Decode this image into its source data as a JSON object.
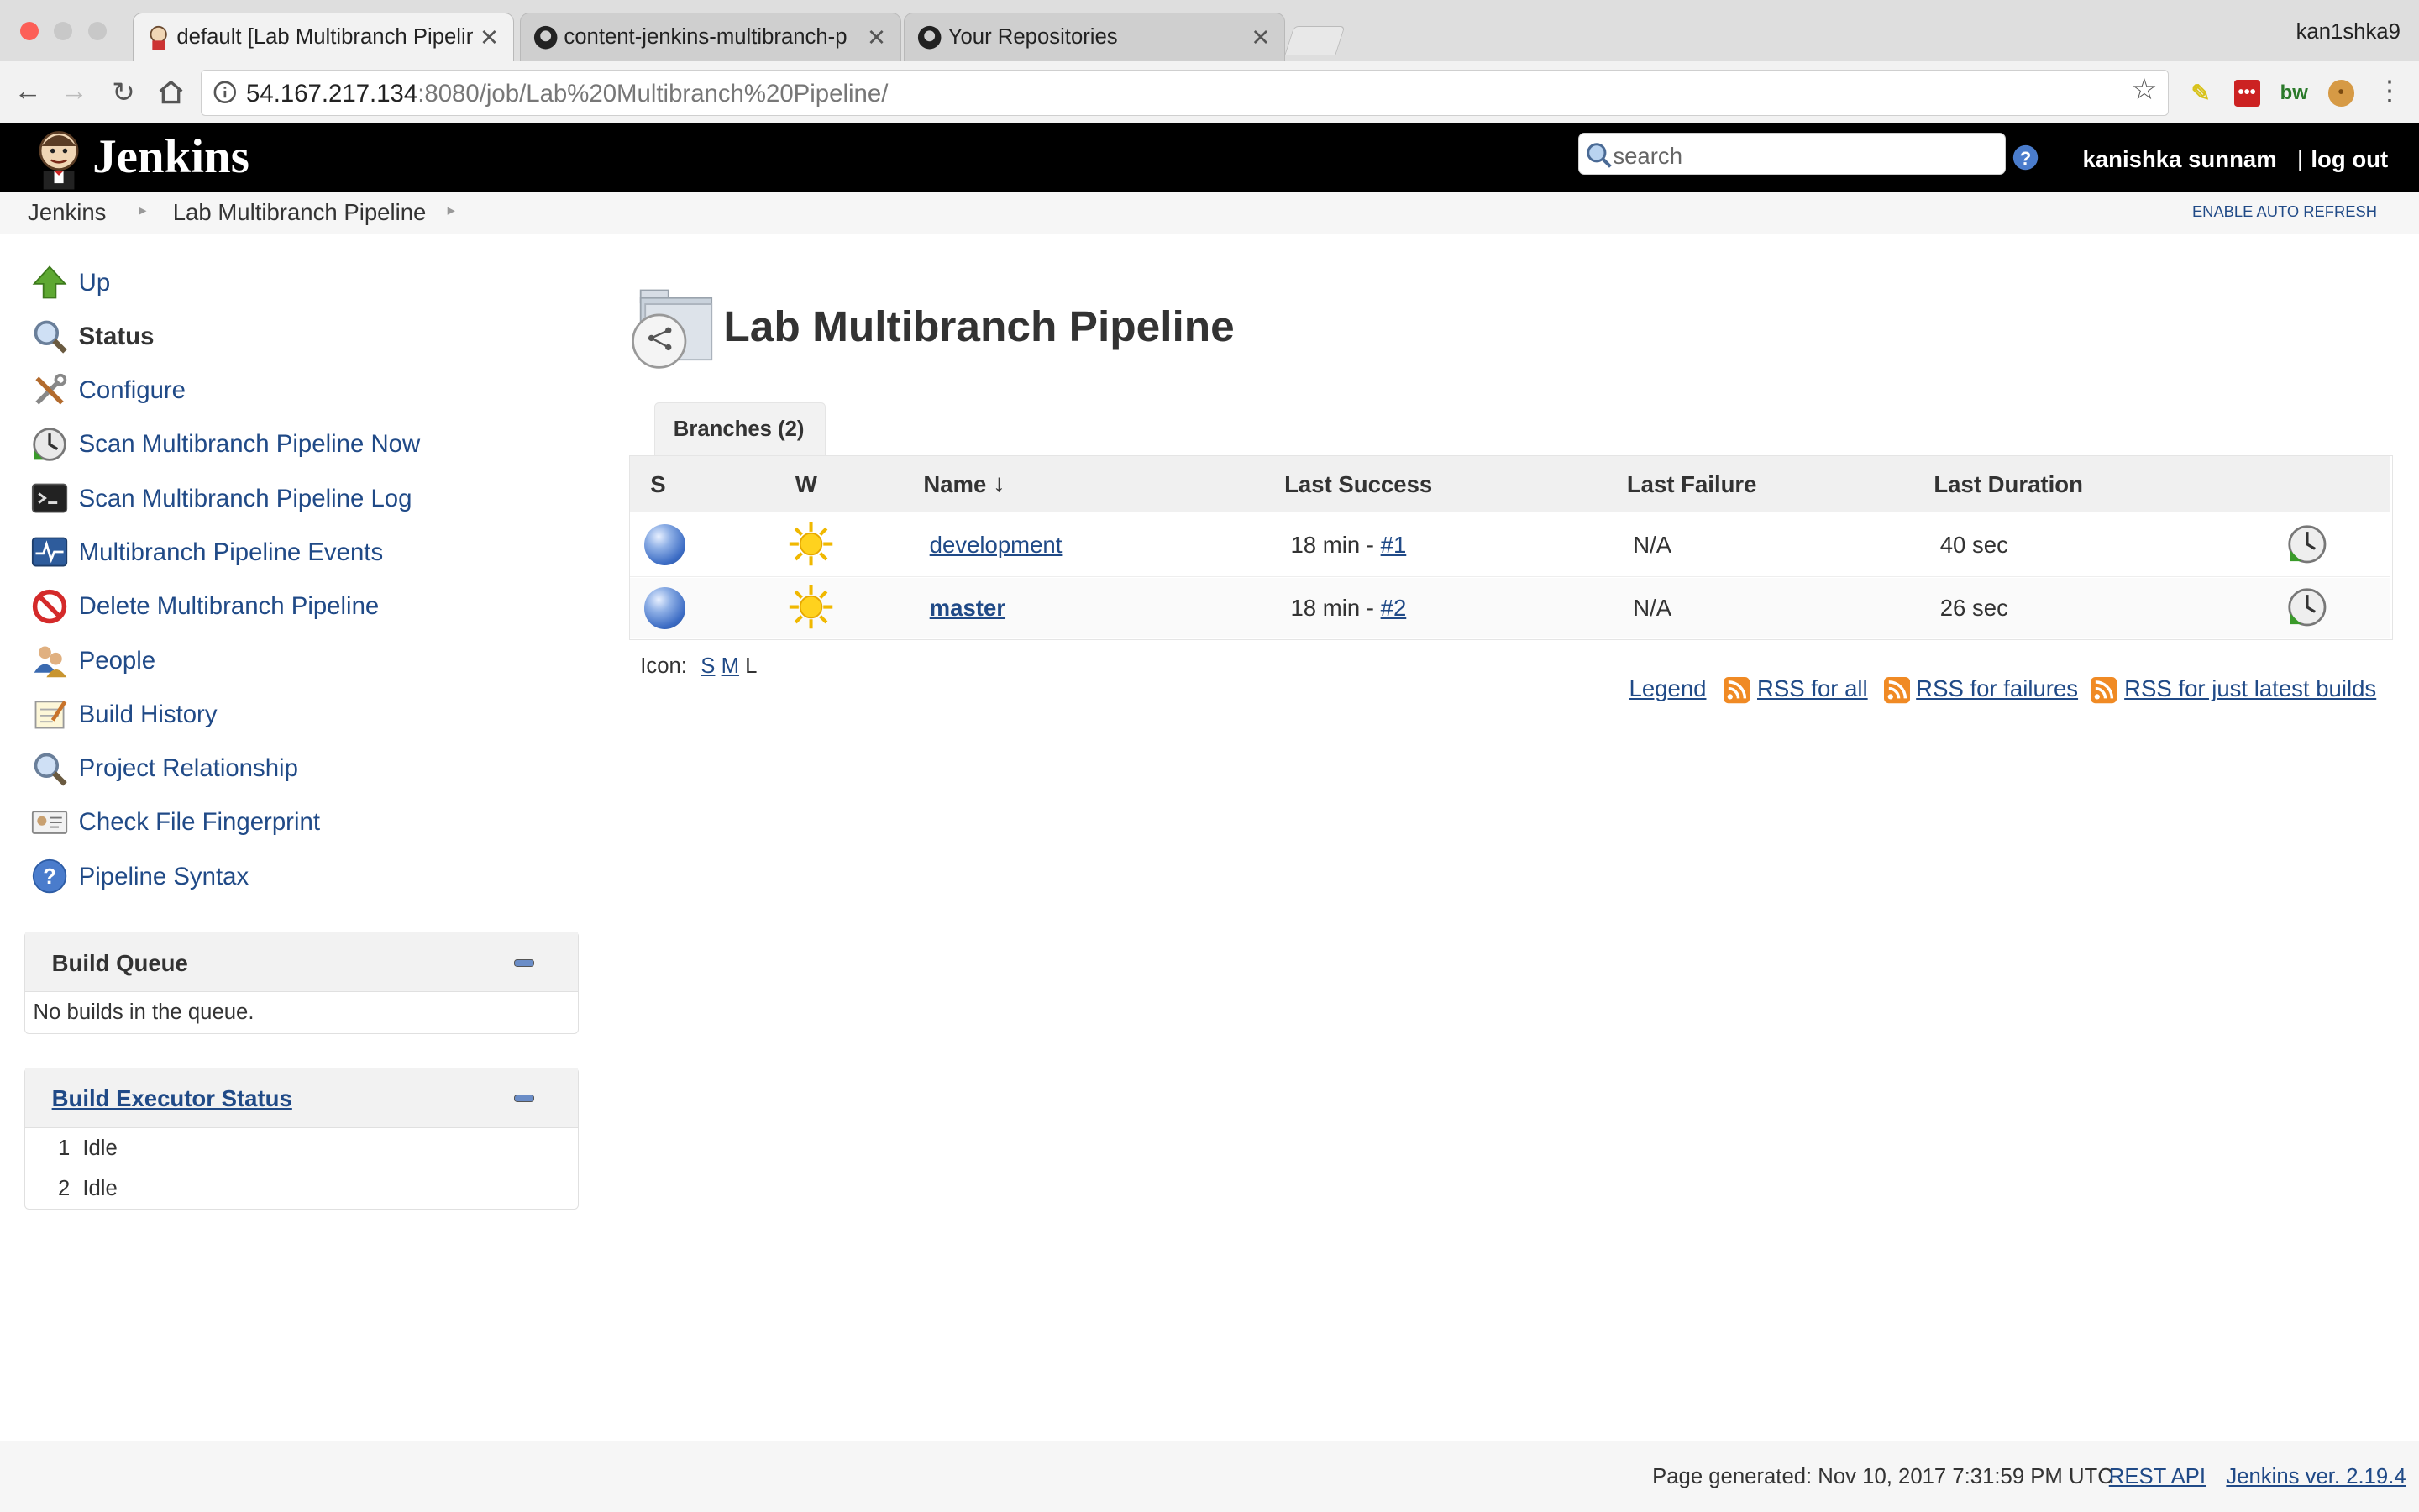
{
  "browser": {
    "tabs": [
      {
        "title": "default [Lab Multibranch Pipeline",
        "active": true
      },
      {
        "title": "content-jenkins-multibranch-p",
        "active": false
      },
      {
        "title": "Your Repositories",
        "active": false
      }
    ],
    "profile_name": "kan1shka9",
    "url_host": "54.167.217.134",
    "url_rest": ":8080/job/Lab%20Multibranch%20Pipeline/",
    "extension_labels": [
      "bw"
    ]
  },
  "header": {
    "logo_text": "Jenkins",
    "search_placeholder": "search",
    "user_name": "kanishka sunnam",
    "logout_label": "log out"
  },
  "breadcrumbs": {
    "items": [
      "Jenkins",
      "Lab Multibranch Pipeline"
    ],
    "auto_refresh_label": "ENABLE AUTO REFRESH"
  },
  "sidebar": {
    "tasks": [
      {
        "label": "Up",
        "icon": "up-arrow-icon"
      },
      {
        "label": "Status",
        "icon": "search-icon"
      },
      {
        "label": "Configure",
        "icon": "tools-icon"
      },
      {
        "label": "Scan Multibranch Pipeline Now",
        "icon": "clock-icon"
      },
      {
        "label": "Scan Multibranch Pipeline Log",
        "icon": "terminal-icon"
      },
      {
        "label": "Multibranch Pipeline Events",
        "icon": "monitor-icon"
      },
      {
        "label": "Delete Multibranch Pipeline",
        "icon": "no-entry-icon"
      },
      {
        "label": "People",
        "icon": "people-icon"
      },
      {
        "label": "Build History",
        "icon": "notepad-icon"
      },
      {
        "label": "Project Relationship",
        "icon": "search-icon"
      },
      {
        "label": "Check File Fingerprint",
        "icon": "fingerprint-icon"
      },
      {
        "label": "Pipeline Syntax",
        "icon": "help-icon"
      }
    ],
    "build_queue": {
      "title": "Build Queue",
      "empty_text": "No builds in the queue."
    },
    "executor_status": {
      "title": "Build Executor Status",
      "executors": [
        {
          "num": "1",
          "state": "Idle"
        },
        {
          "num": "2",
          "state": "Idle"
        }
      ]
    }
  },
  "main": {
    "title": "Lab Multibranch Pipeline",
    "tab_label": "Branches (2)",
    "columns": [
      "S",
      "W",
      "Name",
      "Last Success",
      "Last Failure",
      "Last Duration"
    ],
    "sort_indicator": "↓",
    "rows": [
      {
        "name": "development",
        "success_prefix": "18 min - ",
        "success_link": "#1",
        "failure": "N/A",
        "duration": "40 sec",
        "status_color": "blue",
        "weather": "sunny"
      },
      {
        "name": "master",
        "success_prefix": "18 min - ",
        "success_link": "#2",
        "failure": "N/A",
        "duration": "26 sec",
        "status_color": "blue",
        "weather": "sunny"
      }
    ],
    "icon_size": {
      "label": "Icon:",
      "options": [
        "S",
        "M",
        "L"
      ],
      "selected": "L"
    },
    "legend_label": "Legend",
    "rss": [
      "RSS for all",
      "RSS for failures",
      "RSS for just latest builds"
    ]
  },
  "footer": {
    "generated": "Page generated: Nov 10, 2017 7:31:59 PM UTC",
    "rest_api": "REST API",
    "version": "Jenkins ver. 2.19.4"
  },
  "colors": {
    "link": "#204a87",
    "header_bg": "#000000",
    "status_blue": "#3c6cc4",
    "rss_orange": "#f08a24"
  }
}
